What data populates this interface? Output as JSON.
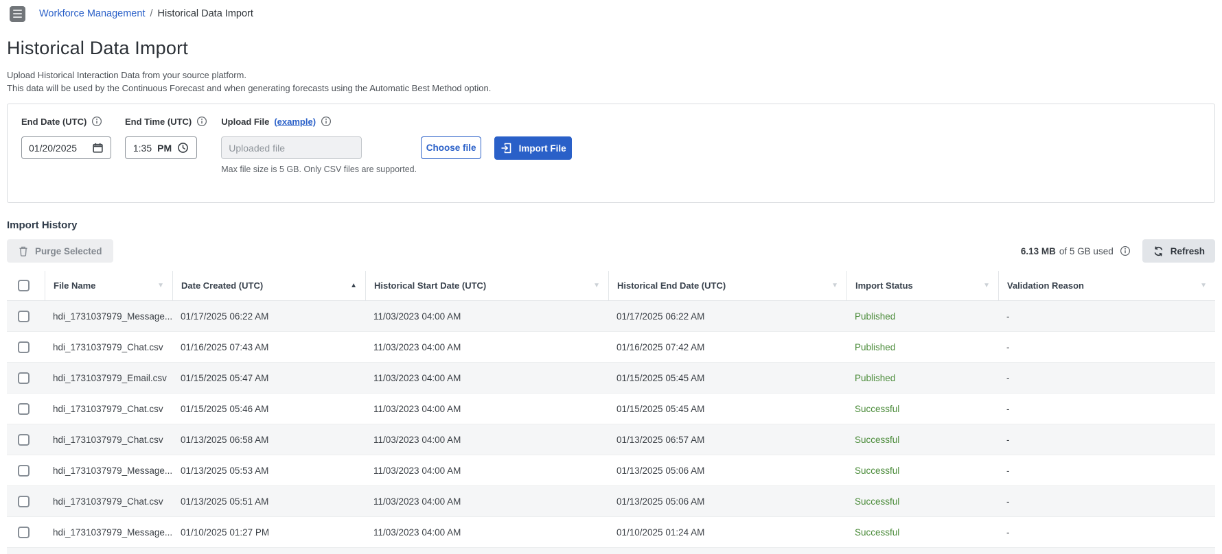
{
  "colors": {
    "accent": "#2a60c8",
    "status_green": "#4a8b39"
  },
  "topbar": {
    "breadcrumb": {
      "parent": "Workforce Management",
      "separator": "/",
      "current": "Historical Data Import"
    }
  },
  "page": {
    "title": "Historical Data Import",
    "description_line1": "Upload Historical Interaction Data from your source platform.",
    "description_line2": "This data will be used by the Continuous Forecast and when generating forecasts using the Automatic Best Method option."
  },
  "form": {
    "end_date": {
      "label": "End Date (UTC)",
      "value": "01/20/2025"
    },
    "end_time": {
      "label": "End Time (UTC)",
      "value": "1:35",
      "meridiem": "PM"
    },
    "upload": {
      "label": "Upload File",
      "example_link": "(example)",
      "placeholder": "Uploaded file",
      "choose_button": "Choose file",
      "import_button": "Import File",
      "help": "Max file size is 5 GB. Only CSV files are supported."
    }
  },
  "history": {
    "heading": "Import History",
    "purge_button": "Purge Selected",
    "storage": {
      "used": "6.13 MB",
      "of_text": "of 5 GB used"
    },
    "refresh_button": "Refresh",
    "table": {
      "columns": [
        {
          "label": "File Name",
          "sort": "none"
        },
        {
          "label": "Date Created (UTC)",
          "sort": "asc"
        },
        {
          "label": "Historical Start Date (UTC)",
          "sort": "none"
        },
        {
          "label": "Historical End Date (UTC)",
          "sort": "none"
        },
        {
          "label": "Import Status",
          "sort": "none"
        },
        {
          "label": "Validation Reason",
          "sort": "none"
        }
      ],
      "rows": [
        {
          "file": "hdi_1731037979_Message...",
          "created": "01/17/2025 06:22 AM",
          "start": "11/03/2023 04:00 AM",
          "end": "01/17/2025 06:22 AM",
          "status": "Published",
          "reason": "-"
        },
        {
          "file": "hdi_1731037979_Chat.csv",
          "created": "01/16/2025 07:43 AM",
          "start": "11/03/2023 04:00 AM",
          "end": "01/16/2025 07:42 AM",
          "status": "Published",
          "reason": "-"
        },
        {
          "file": "hdi_1731037979_Email.csv",
          "created": "01/15/2025 05:47 AM",
          "start": "11/03/2023 04:00 AM",
          "end": "01/15/2025 05:45 AM",
          "status": "Published",
          "reason": "-"
        },
        {
          "file": "hdi_1731037979_Chat.csv",
          "created": "01/15/2025 05:46 AM",
          "start": "11/03/2023 04:00 AM",
          "end": "01/15/2025 05:45 AM",
          "status": "Successful",
          "reason": "-"
        },
        {
          "file": "hdi_1731037979_Chat.csv",
          "created": "01/13/2025 06:58 AM",
          "start": "11/03/2023 04:00 AM",
          "end": "01/13/2025 06:57 AM",
          "status": "Successful",
          "reason": "-"
        },
        {
          "file": "hdi_1731037979_Message...",
          "created": "01/13/2025 05:53 AM",
          "start": "11/03/2023 04:00 AM",
          "end": "01/13/2025 05:06 AM",
          "status": "Successful",
          "reason": "-"
        },
        {
          "file": "hdi_1731037979_Chat.csv",
          "created": "01/13/2025 05:51 AM",
          "start": "11/03/2023 04:00 AM",
          "end": "01/13/2025 05:06 AM",
          "status": "Successful",
          "reason": "-"
        },
        {
          "file": "hdi_1731037979_Message...",
          "created": "01/10/2025 01:27 PM",
          "start": "11/03/2023 04:00 AM",
          "end": "01/10/2025 01:24 AM",
          "status": "Successful",
          "reason": "-"
        }
      ]
    }
  }
}
